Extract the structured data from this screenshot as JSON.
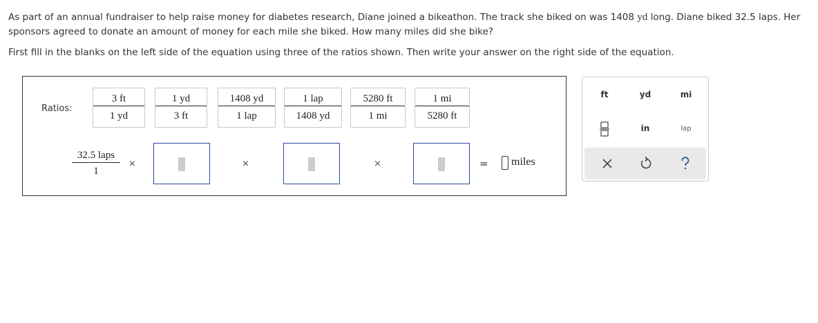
{
  "question": {
    "part1": "As part of an annual fundraiser to help raise money for diabetes research, Diane joined a bikeathon. The track she biked on was 1408",
    "track_unit": "yd",
    "part2": "long. Diane biked 32.5 laps. Her sponsors agreed to donate an amount of money for each mile she biked. How many miles did she bike?"
  },
  "instruction": "First fill in the blanks on the left side of the equation using three of the ratios shown. Then write your answer on the right side of the equation.",
  "ratios_label": "Ratios:",
  "ratios": [
    {
      "num": "3 ft",
      "den": "1 yd"
    },
    {
      "num": "1 yd",
      "den": "3 ft"
    },
    {
      "num": "1408 yd",
      "den": "1 lap"
    },
    {
      "num": "1 lap",
      "den": "1408 yd"
    },
    {
      "num": "5280 ft",
      "den": "1 mi"
    },
    {
      "num": "1 mi",
      "den": "5280 ft"
    }
  ],
  "equation": {
    "start_num": "32.5 laps",
    "start_den": "1",
    "times": "×",
    "equals": "=",
    "answer_value": "",
    "answer_unit": "miles"
  },
  "keypad": {
    "units": [
      "ft",
      "yd",
      "mi",
      "in",
      "lap"
    ],
    "fraction_icon": "fraction-icon",
    "clear_icon": "clear-x-icon",
    "undo_icon": "undo-icon",
    "help_icon": "help-question-icon"
  }
}
